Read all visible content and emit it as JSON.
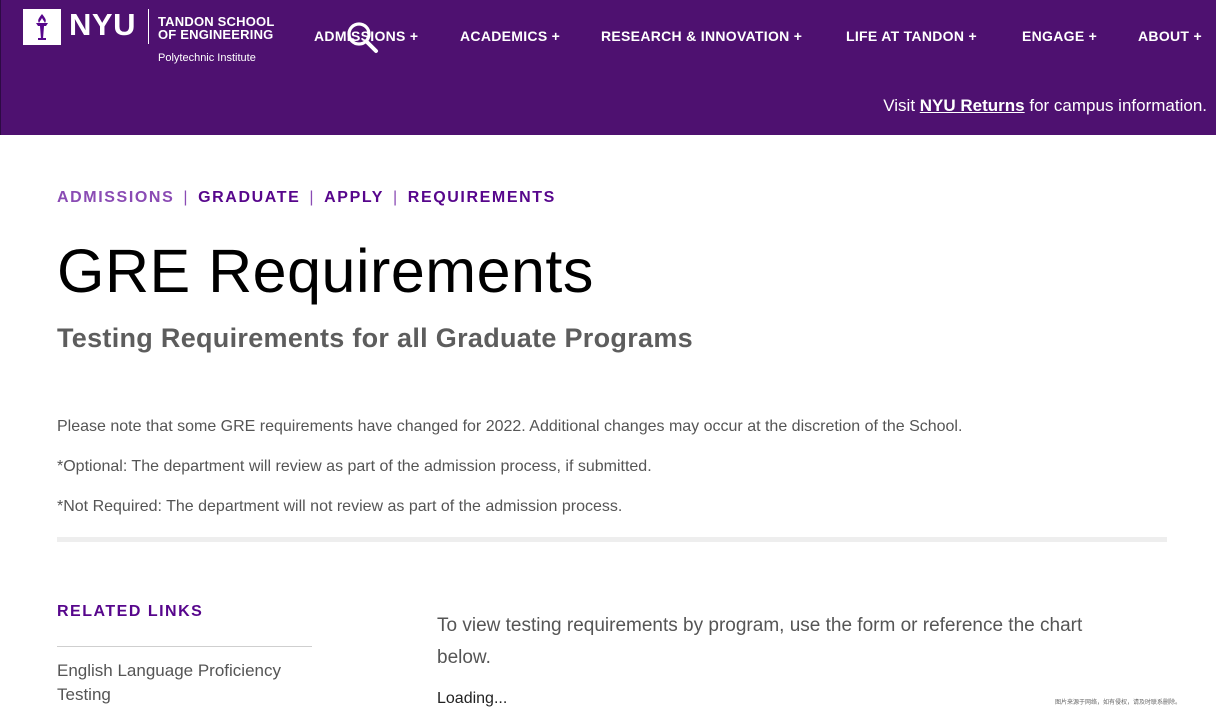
{
  "header": {
    "logo_nyu": "NYU",
    "logo_school_line1": "TANDON SCHOOL",
    "logo_school_line2": "OF ENGINEERING",
    "logo_subtitle": "Polytechnic Institute",
    "brand_color": "#4e1170",
    "nav": [
      {
        "label": "ADMISSIONS +"
      },
      {
        "label": "ACADEMICS +"
      },
      {
        "label": "RESEARCH & INNOVATION +"
      },
      {
        "label": "LIFE AT TANDON +"
      },
      {
        "label": "ENGAGE +"
      },
      {
        "label": "ABOUT +"
      }
    ],
    "notice": {
      "prefix": "Visit ",
      "link": "NYU Returns",
      "suffix": " for campus information."
    }
  },
  "breadcrumb": [
    {
      "label": "ADMISSIONS"
    },
    {
      "label": "GRADUATE"
    },
    {
      "label": "APPLY"
    },
    {
      "label": "REQUIREMENTS"
    }
  ],
  "breadcrumb_separator": "|",
  "page": {
    "title": "GRE Requirements",
    "subtitle": "Testing Requirements for all Graduate Programs",
    "notes": [
      "Please note that some GRE requirements have changed for 2022. Additional changes may occur at the discretion of the School.",
      "*Optional: The department will review as part of the admission process, if submitted.",
      "*Not Required: The department will not review as part of the admission process."
    ]
  },
  "sidebar": {
    "title": "RELATED LINKS",
    "links": [
      {
        "label": "English Language Proficiency Testing"
      }
    ]
  },
  "main": {
    "intro": "To view testing requirements by program, use the form or reference the chart below.",
    "loading": "Loading..."
  },
  "watermark": "图片来源于网络，如有侵权，请及时联系删除。"
}
